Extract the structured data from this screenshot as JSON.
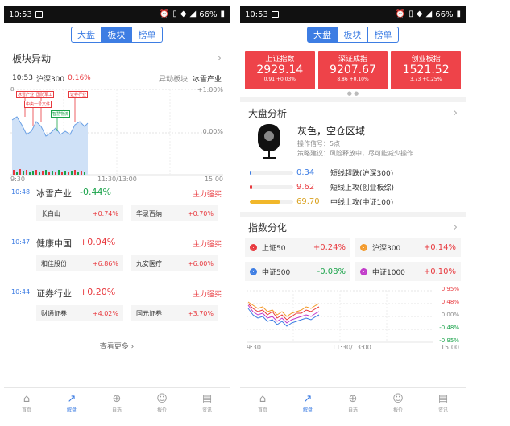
{
  "status": {
    "time": "10:53",
    "battery": "66%"
  },
  "tabs": [
    "大盘",
    "板块",
    "榜单"
  ],
  "left": {
    "section_title": "板块异动",
    "info_time": "10:53",
    "info_index": "沪深300",
    "info_change": "0.16%",
    "info_right_label": "异动板块",
    "info_right_value": "冰雪产业",
    "chart": {
      "y_top": "+1.00%",
      "y_mid": "0.00%",
      "x_start": "9:30",
      "x_mid": "11:30/13:00",
      "x_end": "15:00",
      "markers": [
        "冰雪产业",
        "国防军工",
        "证券行业",
        "中央一号文件",
        "智慧物流"
      ],
      "marker_prefix": "8"
    },
    "events": [
      {
        "time": "10:48",
        "name": "冰雪产业",
        "change": "-0.44%",
        "tag": "主力强买",
        "stocks": [
          {
            "name": "长白山",
            "change": "+0.74%"
          },
          {
            "name": "华录百纳",
            "change": "+0.70%"
          }
        ]
      },
      {
        "time": "10:47",
        "name": "健康中国",
        "change": "+0.04%",
        "tag": "主力强买",
        "stocks": [
          {
            "name": "和佳股份",
            "change": "+6.86%"
          },
          {
            "name": "九安医疗",
            "change": "+6.00%"
          }
        ]
      },
      {
        "time": "10:44",
        "name": "证券行业",
        "change": "+0.20%",
        "tag": "主力强买",
        "stocks": [
          {
            "name": "财通证券",
            "change": "+4.02%"
          },
          {
            "name": "国元证券",
            "change": "+3.70%"
          }
        ]
      }
    ],
    "more": "查看更多"
  },
  "right": {
    "indices": [
      {
        "name": "上证指数",
        "value": "2929.14",
        "change": "0.91 +0.03%"
      },
      {
        "name": "深证成指",
        "value": "9207.67",
        "change": "8.86 +0.10%"
      },
      {
        "name": "创业板指",
        "value": "1521.52",
        "change": "3.73 +0.25%"
      }
    ],
    "analysis": {
      "title": "大盘分析",
      "headline": "灰色，空仓区域",
      "signal": "操作信号：5点",
      "advice": "策略建议：风险释放中，尽可能减少操作",
      "bars": [
        {
          "value": "0.34",
          "label": "短线超跌(沪深300)",
          "fill": 0.03,
          "color": "#3d7de3"
        },
        {
          "value": "9.62",
          "label": "短线上攻(创业板综)",
          "fill": 0.05,
          "color": "#e8383d"
        },
        {
          "value": "69.70",
          "label": "中线上攻(中证100)",
          "fill": 0.7,
          "color": "#f1b72a"
        }
      ]
    },
    "divergence": {
      "title": "指数分化",
      "items": [
        {
          "name": "上证50",
          "change": "+0.24%",
          "color": "#e8383d",
          "cls": "red"
        },
        {
          "name": "沪深300",
          "change": "+0.14%",
          "color": "#f39a2b",
          "cls": "red"
        },
        {
          "name": "中证500",
          "change": "-0.08%",
          "color": "#3d7de3",
          "cls": "green"
        },
        {
          "name": "中证1000",
          "change": "+0.10%",
          "color": "#c13ac9",
          "cls": "red"
        }
      ],
      "y_labels": [
        "0.95%",
        "0.48%",
        "0.00%",
        "-0.48%",
        "-0.95%"
      ],
      "x_start": "9:30",
      "x_mid": "11:30/13:00",
      "x_end": "15:00"
    }
  },
  "tabbar": [
    "首页",
    "解盘",
    "自选",
    "报价",
    "资讯"
  ]
}
